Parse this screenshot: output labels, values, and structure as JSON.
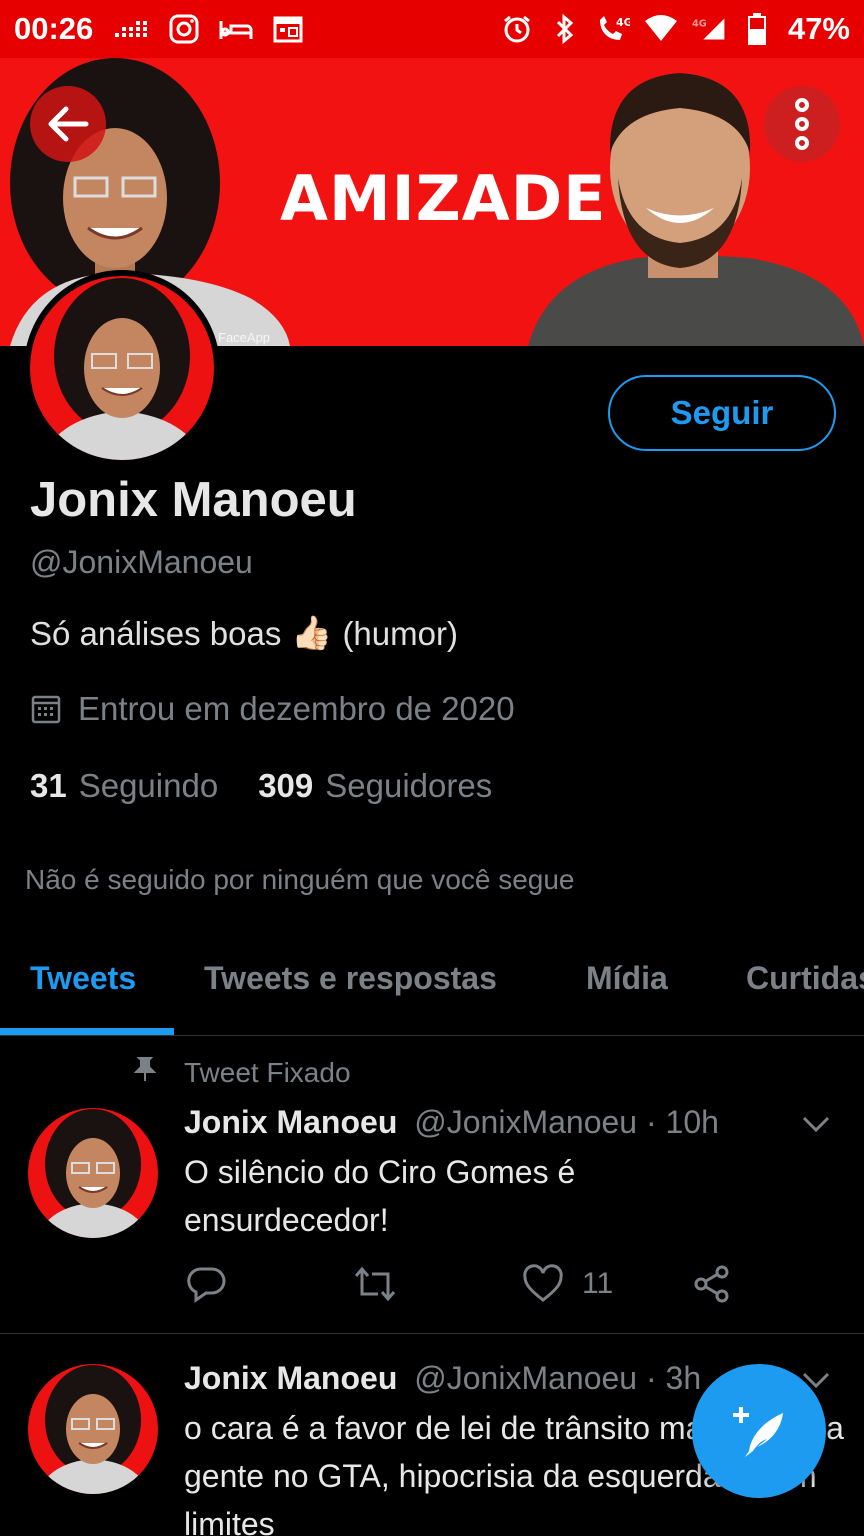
{
  "status_bar": {
    "time": "00:26",
    "battery": "47%",
    "icons_left": [
      "signal-dots-icon",
      "instagram-icon",
      "bed-icon",
      "calendar-icon"
    ],
    "icons_right": [
      "alarm-icon",
      "bluetooth-icon",
      "volte-icon",
      "wifi-icon",
      "cell-signal-icon",
      "battery-icon"
    ]
  },
  "banner": {
    "title": "AMIZADE",
    "watermark": "FaceApp",
    "background_color": "#f21212"
  },
  "profile": {
    "name": "Jonix Manoeu",
    "handle": "@JonixManoeu",
    "bio_before": "Só análises boas",
    "bio_emoji": "👍🏻",
    "bio_after": "(humor)",
    "joined": "Entrou em dezembro de 2020",
    "following_count": "31",
    "following_label": "Seguindo",
    "followers_count": "309",
    "followers_label": "Seguidores",
    "not_followed": "Não é seguido por ninguém que você segue",
    "follow_button": "Seguir"
  },
  "tabs": [
    {
      "label": "Tweets",
      "active": true
    },
    {
      "label": "Tweets e respostas",
      "active": false
    },
    {
      "label": "Mídia",
      "active": false
    },
    {
      "label": "Curtidas",
      "active": false
    }
  ],
  "tweets": [
    {
      "pinned_label": "Tweet Fixado",
      "name": "Jonix Manoeu",
      "meta": "@JonixManoeu · 10h",
      "text": "O silêncio do Ciro Gomes é ensurdecedor!",
      "likes": "11"
    },
    {
      "name": "Jonix Manoeu",
      "meta": "@JonixManoeu · 3h",
      "text": "o cara é a favor de lei de trânsito mas atropela gente no GTA, hipocrisia da esquerda é sem limites"
    }
  ],
  "colors": {
    "accent": "#1d9bf0",
    "status_bar": "#e60000",
    "background": "#000000",
    "secondary_text": "#7b8287"
  }
}
